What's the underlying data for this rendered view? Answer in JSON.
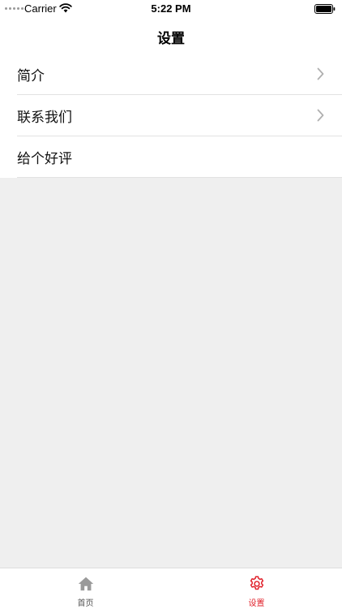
{
  "status_bar": {
    "carrier": "Carrier",
    "time": "5:22 PM"
  },
  "nav": {
    "title": "设置"
  },
  "menu": {
    "items": [
      {
        "label": "简介",
        "has_chevron": true
      },
      {
        "label": "联系我们",
        "has_chevron": true
      },
      {
        "label": "给个好评",
        "has_chevron": false
      }
    ]
  },
  "tab_bar": {
    "tabs": [
      {
        "label": "首页",
        "icon": "home-icon",
        "selected": false
      },
      {
        "label": "设置",
        "icon": "gear-icon",
        "selected": true
      }
    ],
    "active_color": "#e0202a",
    "inactive_color": "#777777"
  }
}
